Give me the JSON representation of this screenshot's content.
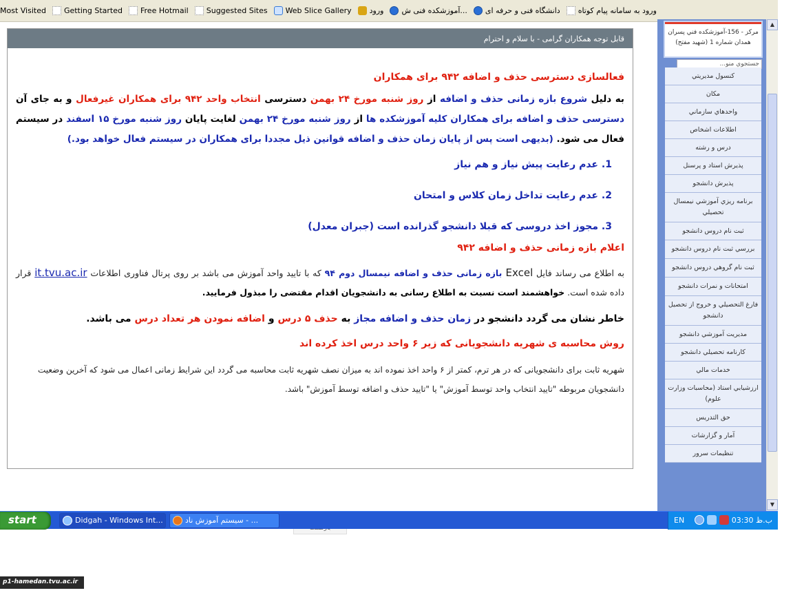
{
  "bookmarks": [
    {
      "label": "Most Visited",
      "icon": "page-icon"
    },
    {
      "label": "Getting Started",
      "icon": "page-icon"
    },
    {
      "label": "Free Hotmail",
      "icon": "page-icon"
    },
    {
      "label": "Suggested Sites",
      "icon": "page-icon"
    },
    {
      "label": "Web Slice Gallery",
      "icon": "ie-icon"
    },
    {
      "label": "ورود",
      "icon": "lock-icon"
    },
    {
      "label": "آموزشکده فنی ش...",
      "icon": "blue-globe-icon"
    },
    {
      "label": "دانشگاه فنی و حرفه ای",
      "icon": "blue-globe-icon"
    },
    {
      "label": "ورود به سامانه پیام کوتاه",
      "icon": "page-icon"
    }
  ],
  "panel": {
    "header": "قابل توجه همکاران گرامی - با سلام و احترام",
    "h1": "فعالسازی دسترسی حذف و اضافه ۹۴۲ برای همکاران",
    "p1": {
      "s1": "به دلیل ",
      "s2": "شروع بازه زمانی حذف و اضافه",
      "s3": " از ",
      "s4": "روز شنبه مورخ ۲۴ بهمن",
      "s5": " دسترسی ",
      "s6": "انتخاب واحد ۹۴۲ برای همکاران غیرفعال",
      "s7": " و به جای آن ",
      "s8": "دسترسی حذف و اضافه برای همکاران کلیه آموزشکده ها",
      "s9": " از ",
      "s10": "روز شنبه مورخ ۲۴ بهمن",
      "s11": " لغایت پایان ",
      "s12": "روز شنبه مورخ ۱۵ اسفند",
      "s13": " در سیستم فعال می شود. ",
      "s14": "(بدیهی است پس از پایان زمان حذف و اضافه قوانین ذیل مجددا برای همکاران در سیستم فعال خواهد بود.)"
    },
    "list": [
      "عدم رعایت پیش نیاز و هم نیاز",
      "عدم رعایت تداخل زمان کلاس و امتحان",
      "مجوز اخذ دروسی که قبلا دانشجو گذرانده است (جبران معدل)"
    ],
    "h2": "اعلام بازه زمانی حذف و اضافه ۹۴۲",
    "p2": {
      "s1": "به اطلاع می رساند فایل ",
      "s2": "Excel",
      "s3": " بازه زمانی حذف و اضافه نیمسال دوم ۹۴",
      "s4": " که با تایید واحد آموزش می باشد بر روی پرتال فناوری اطلاعات ",
      "s5": "it.tvu.ac.ir",
      "s6": " قرار داده شده است. ",
      "s7": "خواهشمند است نسبت به اطلاع رسانی به دانشجویان اقدام مقتضی را مبذول فرمایید."
    },
    "p3": {
      "s1": "خاطر نشان می گردد دانشجو در ",
      "s2": "زمان حذف و اضافه مجاز",
      "s3": " به ",
      "s4": "حذف ۵ درس",
      "s5": " و ",
      "s6": "اضافه نمودن هر تعداد درس",
      "s7": " می باشد."
    },
    "h3": "روش محاسبه ی شهریه دانشجویانی که زیر ۶ واحد درس اخذ کرده اند",
    "p4": "شهریه ثابت برای دانشجویانی که در هر ترم، کمتر از ۶ واحد اخذ نموده اند به میزان نصف شهریه ثابت محاسبه می گردد این شرایط زمانی اعمال می شود که آخرین وضعیت دانشجویان مربوطه \"تایید انتخاب واحد توسط آموزش\" یا \"تایید حذف و اضافه توسط آموزش\" باشد."
  },
  "bottom_stub": "بازگشت",
  "sidebar": {
    "logo_line1": "مرکز - 156-آموزشکده فني پسران",
    "logo_line2": "همدان شماره 1 (شهيد مفتح)",
    "search_placeholder": "جستجوي منو...",
    "menu": [
      "کنسول مديريتي",
      "مکان",
      "واحدهاي سازماني",
      "اطلاعات اشخاص",
      "درس و رشته",
      "پذيرش استاد و پرسنل",
      "پذيرش دانشجو",
      "برنامه ريزي آموزشي نيمسال تحصيلي",
      "ثبت نام دروس دانشجو",
      "بررسي ثبت نام دروس دانشجو",
      "ثبت نام گروهي دروس دانشجو",
      "امتحانات و نمرات دانشجو",
      "فارغ التحصيلي و خروج از تحصيل دانشجو",
      "مديريت آموزشي دانشجو",
      "کارنامه تحصيلي دانشجو",
      "خدمات مالي",
      "ارزشيابي استاد (محاسبات وزارت علوم)",
      "حق التدريس",
      "آمار و گزارشات",
      "تنظيمات سرور"
    ]
  },
  "taskbar": {
    "start": "start",
    "task1": "Didgah - Windows Int...",
    "task2": "سیستم آموزش ناد - ...",
    "lang": "EN",
    "clock": "03:30 ب.ظ"
  },
  "footer_logo": "p1-hamedan.tvu.ac.ir"
}
